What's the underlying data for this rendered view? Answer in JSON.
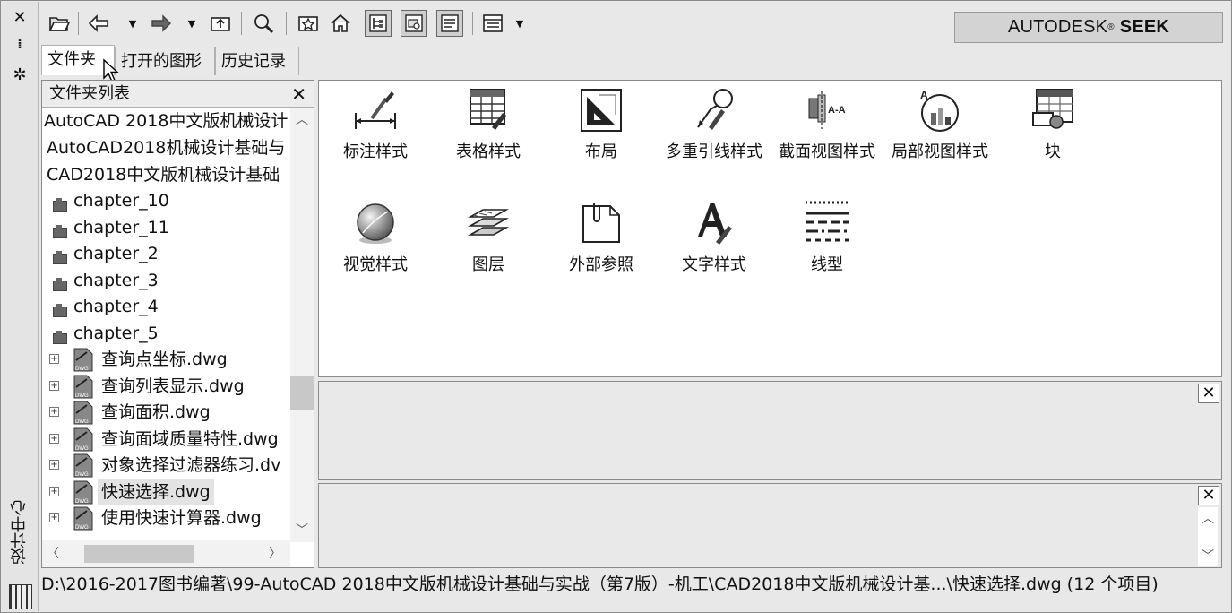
{
  "toolbar": {
    "seek_brand": "AUTODESK",
    "seek_product": "SEEK"
  },
  "strip": {
    "close": "✕",
    "autohide": "⁞",
    "properties": "✲",
    "title": "设计中心"
  },
  "tabs": [
    {
      "label": "文件夹",
      "active": true
    },
    {
      "label": "打开的图形",
      "active": false
    },
    {
      "label": "历史记录",
      "active": false
    }
  ],
  "tree": {
    "header": "文件夹列表",
    "items": [
      {
        "label": "AutoCAD 2018中文版机械设计",
        "type": "root"
      },
      {
        "label": "AutoCAD2018机械设计基础与",
        "type": "root"
      },
      {
        "label": "CAD2018中文版机械设计基础",
        "type": "root"
      },
      {
        "label": "chapter_10",
        "type": "folder"
      },
      {
        "label": "chapter_11",
        "type": "folder"
      },
      {
        "label": "chapter_2",
        "type": "folder"
      },
      {
        "label": "chapter_3",
        "type": "folder"
      },
      {
        "label": "chapter_4",
        "type": "folder"
      },
      {
        "label": "chapter_5",
        "type": "folder"
      },
      {
        "label": "查询点坐标.dwg",
        "type": "dwg"
      },
      {
        "label": "查询列表显示.dwg",
        "type": "dwg"
      },
      {
        "label": "查询面积.dwg",
        "type": "dwg"
      },
      {
        "label": "查询面域质量特性.dwg",
        "type": "dwg"
      },
      {
        "label": "对象选择过滤器练习.dv",
        "type": "dwg"
      },
      {
        "label": "快速选择.dwg",
        "type": "dwg",
        "selected": true
      },
      {
        "label": "使用快速计算器.dwg",
        "type": "dwg"
      }
    ]
  },
  "content": {
    "items": [
      {
        "label": "标注样式",
        "icon": "dimension-style-icon"
      },
      {
        "label": "表格样式",
        "icon": "table-style-icon"
      },
      {
        "label": "布局",
        "icon": "layout-icon"
      },
      {
        "label": "多重引线样式",
        "icon": "multileader-style-icon"
      },
      {
        "label": "截面视图样式",
        "icon": "section-view-style-icon"
      },
      {
        "label": "局部视图样式",
        "icon": "detail-view-style-icon"
      },
      {
        "label": "块",
        "icon": "block-icon"
      },
      {
        "label": "视觉样式",
        "icon": "visual-style-icon"
      },
      {
        "label": "图层",
        "icon": "layers-icon"
      },
      {
        "label": "外部参照",
        "icon": "xref-icon"
      },
      {
        "label": "文字样式",
        "icon": "text-style-icon"
      },
      {
        "label": "线型",
        "icon": "linetype-icon"
      }
    ]
  },
  "status": {
    "path": "D:\\2016-2017图书编著\\99-AutoCAD 2018中文版机械设计基础与实战（第7版）-机工\\CAD2018中文版机械设计基...\\快速选择.dwg (12 个项目)"
  }
}
